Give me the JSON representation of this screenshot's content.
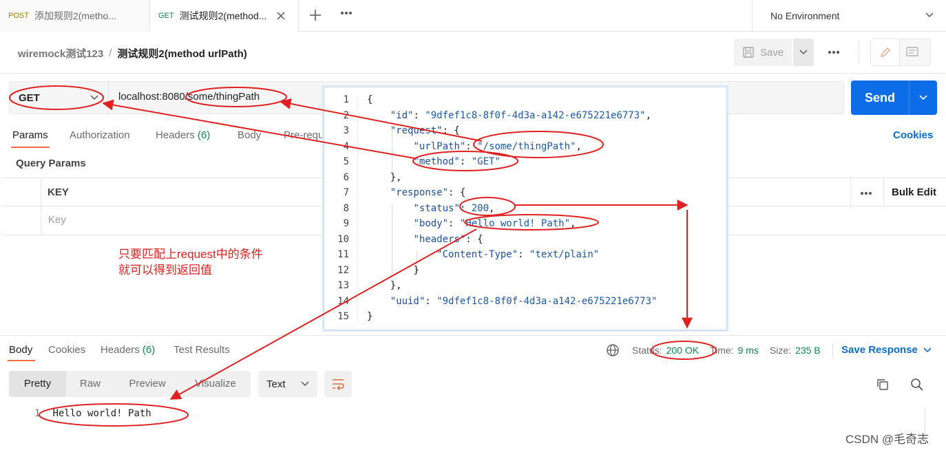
{
  "tabs": [
    {
      "method": "POST",
      "title": "添加规则2(metho..."
    },
    {
      "method": "GET",
      "title": "测试规则2(method..."
    }
  ],
  "environment": "No Environment",
  "breadcrumb": {
    "collection": "wiremock测试123",
    "separator": "/",
    "request": "测试规则2(method urlPath)"
  },
  "toolbar": {
    "save_label": "Save"
  },
  "request": {
    "method": "GET",
    "url": "localhost:8080/some/thingPath",
    "send_label": "Send",
    "tabs": [
      "Params",
      "Authorization",
      "Headers",
      "(6)",
      "Body",
      "Pre-requ"
    ],
    "cookies_label": "Cookies",
    "query_params_label": "Query Params",
    "table": {
      "key_header": "KEY",
      "key_placeholder": "Key",
      "bulk_edit": "Bulk Edit"
    }
  },
  "annotation": {
    "line1": "只要匹配上request中的条件",
    "line2": "就可以得到返回值"
  },
  "json_lines": [
    {
      "n": "1",
      "text": "{"
    },
    {
      "n": "2",
      "text": "    \"id\": \"9dfef1c8-8f0f-4d3a-a142-e675221e6773\","
    },
    {
      "n": "3",
      "text": "    \"request\": {"
    },
    {
      "n": "4",
      "text": "        \"urlPath\": \"/some/thingPath\","
    },
    {
      "n": "5",
      "text": "        \"method\": \"GET\""
    },
    {
      "n": "6",
      "text": "    },"
    },
    {
      "n": "7",
      "text": "    \"response\": {"
    },
    {
      "n": "8",
      "text": "        \"status\": 200,"
    },
    {
      "n": "9",
      "text": "        \"body\": \"Hello world! Path\","
    },
    {
      "n": "10",
      "text": "        \"headers\": {"
    },
    {
      "n": "11",
      "text": "            \"Content-Type\": \"text/plain\""
    },
    {
      "n": "12",
      "text": "        }"
    },
    {
      "n": "13",
      "text": "    },"
    },
    {
      "n": "14",
      "text": "    \"uuid\": \"9dfef1c8-8f0f-4d3a-a142-e675221e6773\""
    },
    {
      "n": "15",
      "text": "}"
    }
  ],
  "response": {
    "tabs": [
      "Body",
      "Cookies",
      "Headers",
      "(6)",
      "Test Results"
    ],
    "status_label": "Status:",
    "status_value": "200 OK",
    "time_label": "Time:",
    "time_value": "9 ms",
    "size_label": "Size:",
    "size_value": "235 B",
    "save_response": "Save Response",
    "views": [
      "Pretty",
      "Raw",
      "Preview",
      "Visualize"
    ],
    "format": "Text",
    "body_line_number": "1",
    "body_text": "Hello world! Path"
  },
  "watermark": "CSDN @毛奇志",
  "colors": {
    "accent": "#0d6de8",
    "annotation": "#e02020",
    "tab_underline": "#f26b3a",
    "status_green": "#0a8a4c"
  }
}
